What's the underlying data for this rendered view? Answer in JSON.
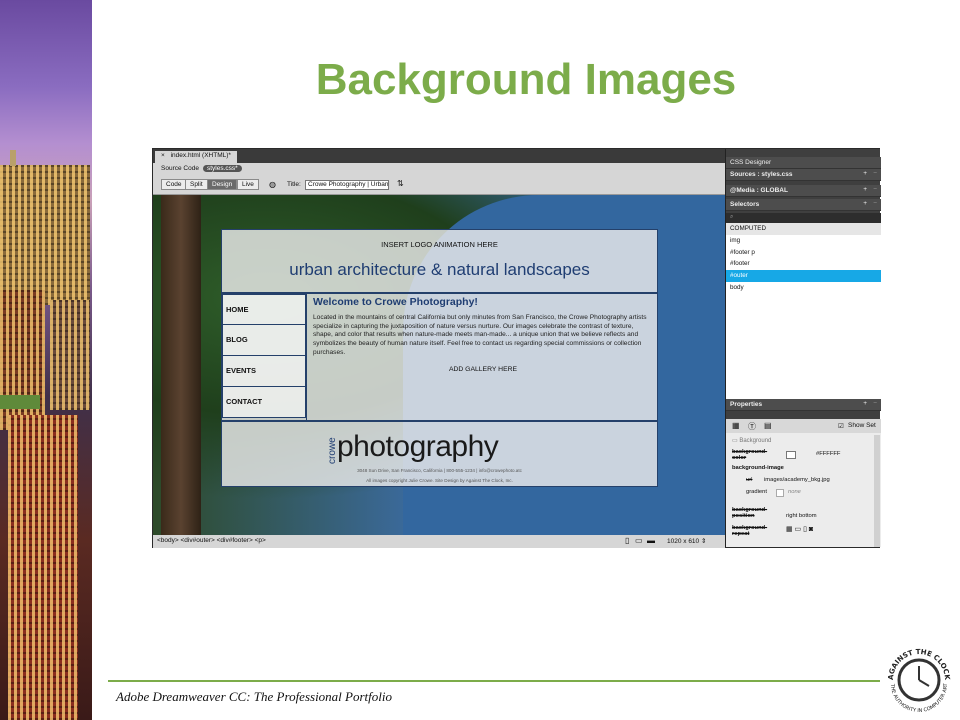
{
  "slide": {
    "title": "Background Images",
    "footer": "Adobe Dreamweaver CC: The Professional Portfolio",
    "logo_text_top": "AGAINST THE CLOCK",
    "logo_text_bottom": "THE AUTHORITY IN COMPUTER ARTS"
  },
  "editor": {
    "doc_tab": "index.html (XHTML)*",
    "close_glyph": "×",
    "source_code_label": "Source Code",
    "css_file_pill": "styles.css*",
    "view_buttons": [
      "Code",
      "Split",
      "Design",
      "Live"
    ],
    "title_label": "Title:",
    "title_value": "Crowe Photography | Urban A",
    "statusbar_path": "<body> <div#outer> <div#footer> <p>",
    "viewport_size": "1020 x 610 ⇕"
  },
  "page_preview": {
    "logo_placeholder": "INSERT LOGO ANIMATION HERE",
    "tagline": "urban architecture & natural landscapes",
    "nav": [
      "HOME",
      "BLOG",
      "EVENTS",
      "CONTACT"
    ],
    "welcome": "Welcome to Crowe Photography!",
    "paragraph": "Located in the mountains of central California but only minutes from San Francisco, the Crowe Photography artists specialize in capturing the juxtaposition of nature versus nurture. Our images celebrate the contrast of texture, shape, and color that results when nature-made meets man-made... a unique union that we believe reflects and symbolizes the beauty of human nature itself. Feel free to contact us regarding special commissions or collection purchases.",
    "gallery": "ADD GALLERY HERE",
    "logo_small": "crowe",
    "logo_word": "photography",
    "address": "3048 Sun Drive, San Francisco, California | 800-555-1234 | info@crowephoto.atc",
    "copyright": "All images copyright Julie Crowe. Site Design by Against The Clock, Inc."
  },
  "css_designer": {
    "panel_title": "CSS Designer",
    "sources_label": "Sources : styles.css",
    "media_label": "@Media : GLOBAL",
    "selectors_label": "Selectors",
    "selectors": [
      "COMPUTED",
      "img",
      "#footer p",
      "#footer",
      "#outer",
      "body"
    ],
    "selected_selector": "#outer",
    "properties_label": "Properties",
    "show_set_label": "Show Set",
    "background_section": "Background",
    "bg_color_label": "background-color",
    "bg_color_value": "#FFFFFF",
    "bg_image_label": "background-image",
    "url_label": "url",
    "url_value": "images/academy_bkg.jpg",
    "gradient_label": "gradient",
    "gradient_value": "none",
    "bg_position_label": "background-position",
    "bg_position_value": "right  bottom",
    "bg_repeat_label": "background-repeat"
  },
  "colors": {
    "title_green": "#7cac4a",
    "selection_blue": "#17a8e6",
    "page_navy": "#1f3d72"
  }
}
